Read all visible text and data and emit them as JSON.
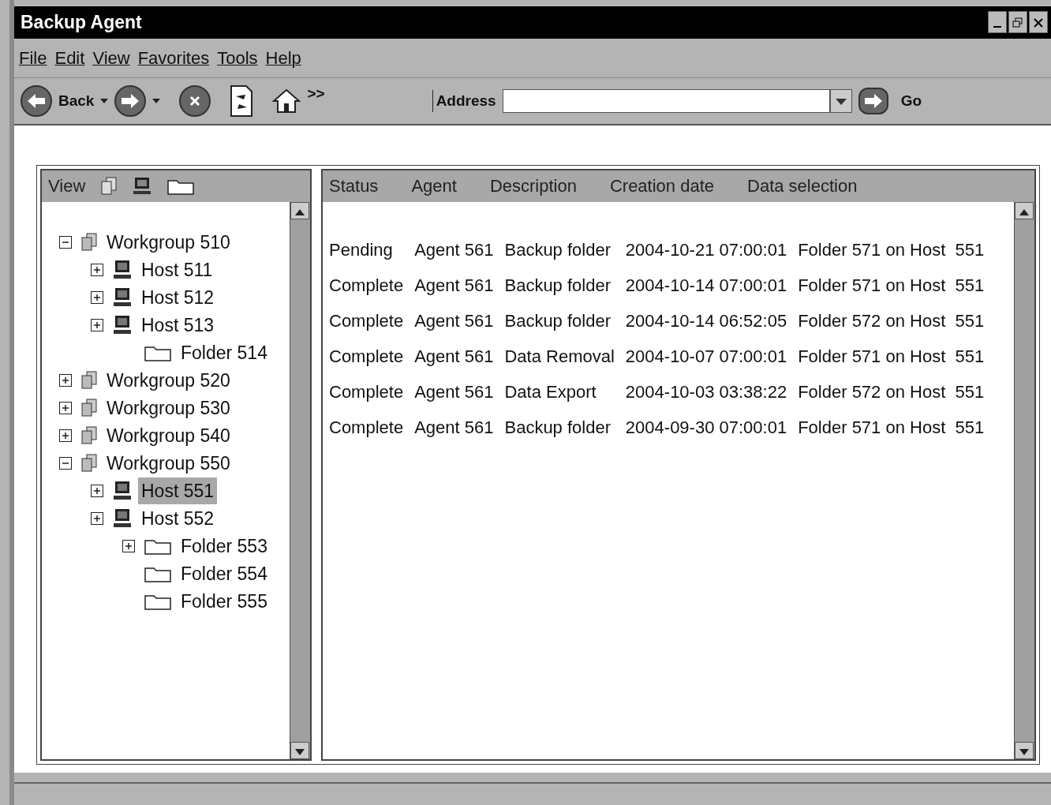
{
  "window": {
    "title": "Backup Agent"
  },
  "menu": [
    {
      "label": "File"
    },
    {
      "label": "Edit"
    },
    {
      "label": "View"
    },
    {
      "label": "Favorites"
    },
    {
      "label": "Tools"
    },
    {
      "label": "Help"
    }
  ],
  "toolbar": {
    "back_label": "Back",
    "more": ">>",
    "address_label": "Address",
    "go_label": "Go"
  },
  "tree": {
    "header": "View",
    "nodes": [
      {
        "label": "Workgroup 510",
        "kind": "workgroup",
        "expanded": true,
        "selected": false,
        "children": [
          {
            "label": "Host 511",
            "kind": "host",
            "expanded": false,
            "selected": false
          },
          {
            "label": "Host 512",
            "kind": "host",
            "expanded": false,
            "selected": false
          },
          {
            "label": "Host 513",
            "kind": "host",
            "expanded": false,
            "selected": false,
            "children": [
              {
                "label": "Folder 514",
                "kind": "folder",
                "selected": false
              }
            ]
          }
        ]
      },
      {
        "label": "Workgroup 520",
        "kind": "workgroup",
        "expanded": false,
        "selected": false
      },
      {
        "label": "Workgroup 530",
        "kind": "workgroup",
        "expanded": false,
        "selected": false
      },
      {
        "label": "Workgroup 540",
        "kind": "workgroup",
        "expanded": false,
        "selected": false
      },
      {
        "label": "Workgroup 550",
        "kind": "workgroup",
        "expanded": true,
        "selected": false,
        "children": [
          {
            "label": "Host 551",
            "kind": "host",
            "expanded": false,
            "selected": true
          },
          {
            "label": "Host 552",
            "kind": "host",
            "expanded": false,
            "selected": false,
            "children": [
              {
                "label": "Folder 553",
                "kind": "folder",
                "expanded": false,
                "selected": false
              },
              {
                "label": "Folder 554",
                "kind": "folder",
                "selected": false
              },
              {
                "label": "Folder 555",
                "kind": "folder",
                "selected": false
              }
            ]
          }
        ]
      }
    ]
  },
  "table": {
    "columns": [
      "Status",
      "Agent",
      "Description",
      "Creation date",
      "Data selection"
    ],
    "rows": [
      [
        "Pending",
        "Agent 561",
        "Backup folder",
        "2004-10-21 07:00:01",
        "Folder 571 on Host  551"
      ],
      [
        "Complete",
        "Agent 561",
        "Backup folder",
        "2004-10-14 07:00:01",
        "Folder 571 on Host  551"
      ],
      [
        "Complete",
        "Agent 561",
        "Backup folder",
        "2004-10-14 06:52:05",
        "Folder 572 on Host  551"
      ],
      [
        "Complete",
        "Agent 561",
        "Data Removal",
        "2004-10-07 07:00:01",
        "Folder 571 on Host  551"
      ],
      [
        "Complete",
        "Agent 561",
        "Data Export",
        "2004-10-03 03:38:22",
        "Folder 572 on Host  551"
      ],
      [
        "Complete",
        "Agent 561",
        "Backup folder",
        "2004-09-30 07:00:01",
        "Folder 571 on Host  551"
      ]
    ]
  }
}
